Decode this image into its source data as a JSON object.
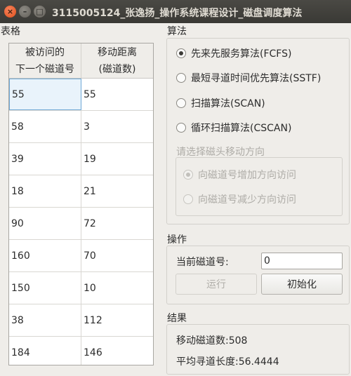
{
  "window": {
    "title": "3115005124_张逸扬_操作系统课程设计_磁盘调度算法",
    "close_glyph": "×",
    "min_glyph": "–",
    "max_glyph": "□"
  },
  "table": {
    "section_label": "表格",
    "headers": [
      {
        "line1": "被访问的",
        "line2": "下一个磁道号"
      },
      {
        "line1": "移动距离",
        "line2": "(磁道数)"
      }
    ],
    "rows": [
      {
        "track": "55",
        "distance": "55"
      },
      {
        "track": "58",
        "distance": "3"
      },
      {
        "track": "39",
        "distance": "19"
      },
      {
        "track": "18",
        "distance": "21"
      },
      {
        "track": "90",
        "distance": "72"
      },
      {
        "track": "160",
        "distance": "70"
      },
      {
        "track": "150",
        "distance": "10"
      },
      {
        "track": "38",
        "distance": "112"
      },
      {
        "track": "184",
        "distance": "146"
      }
    ]
  },
  "algorithm": {
    "section_label": "算法",
    "options": [
      {
        "label": "先来先服务算法(FCFS)",
        "checked": true
      },
      {
        "label": "最短寻道时间优先算法(SSTF)",
        "checked": false
      },
      {
        "label": "扫描算法(SCAN)",
        "checked": false
      },
      {
        "label": "循环扫描算法(CSCAN)",
        "checked": false
      }
    ],
    "direction_label": "请选择磁头移动方向",
    "direction_options": [
      {
        "label": "向磁道号增加方向访问",
        "checked": true
      },
      {
        "label": "向磁道号减少方向访问",
        "checked": false
      }
    ]
  },
  "operation": {
    "section_label": "操作",
    "current_track_label": "当前磁道号:",
    "current_track_value": "0",
    "run_label": "运行",
    "init_label": "初始化"
  },
  "result": {
    "section_label": "结果",
    "moved_tracks": "移动磁道数:508",
    "avg_seek": "平均寻道长度:56.4444"
  }
}
